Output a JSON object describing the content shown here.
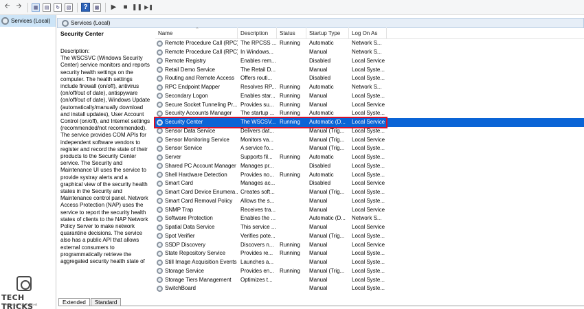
{
  "toolbar": {
    "buttons": [
      "back-arrow",
      "forward-arrow",
      "show-hide-console-tree",
      "export-list",
      "refresh",
      "properties",
      "help",
      "action-pane",
      "start-service",
      "stop-service",
      "pause-service",
      "restart-service"
    ]
  },
  "tree": {
    "root_label": "Services (Local)"
  },
  "header": {
    "title": "Services (Local)"
  },
  "description_pane": {
    "service_title": "Security Center",
    "label": "Description:",
    "text": "The WSCSVC (Windows Security Center) service monitors and reports security health settings on the computer.  The health settings include firewall (on/off), antivirus (on/off/out of date), antispyware (on/off/out of date), Windows Update (automatically/manually download and install updates), User Account Control (on/off), and Internet settings (recommended/not recommended). The service provides COM APIs for independent software vendors to register and record the state of their products to the Security Center service.  The Security and Maintenance UI uses the service to provide systray alerts and a graphical view of the security health states in the Security and Maintenance control panel.  Network Access Protection (NAP) uses the service to report the security health states of clients to the NAP Network Policy Server to make network quarantine decisions.  The service also has a public API that allows external consumers to programmatically retrieve the aggregated security health state of"
  },
  "columns": [
    "Name",
    "Description",
    "Status",
    "Startup Type",
    "Log On As"
  ],
  "rows": [
    {
      "name": "Remote Procedure Call (RPC)",
      "desc": "The RPCSS ...",
      "status": "Running",
      "startup": "Automatic",
      "logon": "Network S..."
    },
    {
      "name": "Remote Procedure Call (RPC) ...",
      "desc": "In Windows...",
      "status": "",
      "startup": "Manual",
      "logon": "Network S..."
    },
    {
      "name": "Remote Registry",
      "desc": "Enables rem...",
      "status": "",
      "startup": "Disabled",
      "logon": "Local Service"
    },
    {
      "name": "Retail Demo Service",
      "desc": "The Retail D...",
      "status": "",
      "startup": "Manual",
      "logon": "Local Syste..."
    },
    {
      "name": "Routing and Remote Access",
      "desc": "Offers routi...",
      "status": "",
      "startup": "Disabled",
      "logon": "Local Syste..."
    },
    {
      "name": "RPC Endpoint Mapper",
      "desc": "Resolves RP...",
      "status": "Running",
      "startup": "Automatic",
      "logon": "Network S..."
    },
    {
      "name": "Secondary Logon",
      "desc": "Enables star...",
      "status": "Running",
      "startup": "Manual",
      "logon": "Local Syste..."
    },
    {
      "name": "Secure Socket Tunneling Pr...",
      "desc": "Provides su...",
      "status": "Running",
      "startup": "Manual",
      "logon": "Local Service"
    },
    {
      "name": "Security Accounts Manager",
      "desc": "The startup ...",
      "status": "Running",
      "startup": "Automatic",
      "logon": "Local Syste..."
    },
    {
      "name": "Security Center",
      "desc": "The WSCSV...",
      "status": "Running",
      "startup": "Automatic (D...",
      "logon": "Local Service",
      "selected": true
    },
    {
      "name": "Sensor Data Service",
      "desc": "Delivers dat...",
      "status": "",
      "startup": "Manual (Trig...",
      "logon": "Local Syste..."
    },
    {
      "name": "Sensor Monitoring Service",
      "desc": "Monitors va...",
      "status": "",
      "startup": "Manual (Trig...",
      "logon": "Local Service"
    },
    {
      "name": "Sensor Service",
      "desc": "A service fo...",
      "status": "",
      "startup": "Manual (Trig...",
      "logon": "Local Syste..."
    },
    {
      "name": "Server",
      "desc": "Supports fil...",
      "status": "Running",
      "startup": "Automatic",
      "logon": "Local Syste..."
    },
    {
      "name": "Shared PC Account Manager",
      "desc": "Manages pr...",
      "status": "",
      "startup": "Disabled",
      "logon": "Local Syste..."
    },
    {
      "name": "Shell Hardware Detection",
      "desc": "Provides no...",
      "status": "Running",
      "startup": "Automatic",
      "logon": "Local Syste..."
    },
    {
      "name": "Smart Card",
      "desc": "Manages ac...",
      "status": "",
      "startup": "Disabled",
      "logon": "Local Service"
    },
    {
      "name": "Smart Card Device Enumera...",
      "desc": "Creates soft...",
      "status": "",
      "startup": "Manual (Trig...",
      "logon": "Local Syste..."
    },
    {
      "name": "Smart Card Removal Policy",
      "desc": "Allows the s...",
      "status": "",
      "startup": "Manual",
      "logon": "Local Syste..."
    },
    {
      "name": "SNMP Trap",
      "desc": "Receives tra...",
      "status": "",
      "startup": "Manual",
      "logon": "Local Service"
    },
    {
      "name": "Software Protection",
      "desc": "Enables the ...",
      "status": "",
      "startup": "Automatic (D...",
      "logon": "Network S..."
    },
    {
      "name": "Spatial Data Service",
      "desc": "This service ...",
      "status": "",
      "startup": "Manual",
      "logon": "Local Service"
    },
    {
      "name": "Spot Verifier",
      "desc": "Verifies pote...",
      "status": "",
      "startup": "Manual (Trig...",
      "logon": "Local Syste..."
    },
    {
      "name": "SSDP Discovery",
      "desc": "Discovers n...",
      "status": "Running",
      "startup": "Manual",
      "logon": "Local Service"
    },
    {
      "name": "State Repository Service",
      "desc": "Provides re...",
      "status": "Running",
      "startup": "Manual",
      "logon": "Local Syste..."
    },
    {
      "name": "Still Image Acquisition Events",
      "desc": "Launches a...",
      "status": "",
      "startup": "Manual",
      "logon": "Local Syste..."
    },
    {
      "name": "Storage Service",
      "desc": "Provides en...",
      "status": "Running",
      "startup": "Manual (Trig...",
      "logon": "Local Syste..."
    },
    {
      "name": "Storage Tiers Management",
      "desc": "Optimizes t...",
      "status": "",
      "startup": "Manual",
      "logon": "Local Syste..."
    },
    {
      "name": "SwitchBoard",
      "desc": "",
      "status": "",
      "startup": "Manual",
      "logon": "Local Syste..."
    }
  ],
  "tabs": [
    "Extended",
    "Standard"
  ],
  "watermark": {
    "text": "TECH TRICKS",
    "sub": "THỦ THUẬT CÔNG NGHỆ"
  },
  "colors": {
    "selection": "#0a64d6",
    "highlight_border": "#d8112a",
    "header_bg": "#e6eef7"
  }
}
